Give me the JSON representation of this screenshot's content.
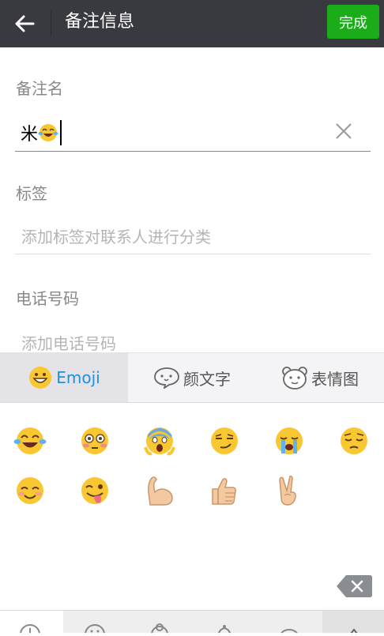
{
  "header": {
    "title": "备注信息",
    "done_label": "完成"
  },
  "remark": {
    "label": "备注名",
    "value": "米"
  },
  "tags": {
    "label": "标签",
    "placeholder": "添加标签对联系人进行分类"
  },
  "phone": {
    "label": "电话号码",
    "placeholder": "添加电话号码"
  },
  "emoji_tabs": [
    {
      "label": "Emoji",
      "selected": true
    },
    {
      "label": "颜文字",
      "selected": false
    },
    {
      "label": "表情图",
      "selected": false
    }
  ],
  "emoji_grid": [
    {
      "name": "tears-of-joy"
    },
    {
      "name": "flushed"
    },
    {
      "name": "screaming"
    },
    {
      "name": "smirk"
    },
    {
      "name": "crying"
    },
    {
      "name": "pensive"
    },
    {
      "name": "smiling"
    },
    {
      "name": "winking-tongue"
    },
    {
      "name": "flexed-biceps"
    },
    {
      "name": "thumbs-up"
    },
    {
      "name": "victory-hand"
    }
  ],
  "colors": {
    "appbar": "#393a3f",
    "accent": "#1aad19",
    "tab_selected": "#1f8fe0",
    "emoji_yellow": "#f8c732"
  }
}
